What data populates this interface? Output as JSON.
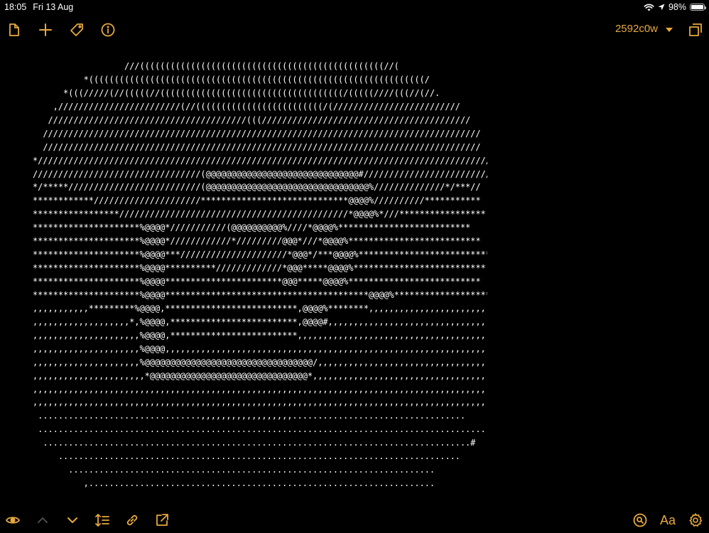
{
  "status_bar": {
    "time": "18:05",
    "date": "Fri 13 Aug",
    "battery_percent": "98%",
    "battery_level": 0.98,
    "icons": [
      "wifi-icon",
      "location-arrow-icon",
      "battery-icon"
    ]
  },
  "toolbar_top": {
    "left_icons": [
      "document-icon",
      "plus-icon",
      "tag-icon",
      "info-icon"
    ],
    "document_title": "2592c0w",
    "right_icons": [
      "chevron-down-icon",
      "window-icon"
    ]
  },
  "toolbar_bottom": {
    "left_icons": [
      "eye-icon",
      "chevron-up-icon",
      "chevron-down-icon",
      "line-spacing-icon",
      "link-icon",
      "share-icon"
    ],
    "right_icons": [
      "search-icon",
      "font-icon",
      "settings-icon"
    ],
    "font_label": "Aa"
  },
  "colors": {
    "accent": "#e8a93c",
    "background": "#000000",
    "text": "#ffffff",
    "disabled": "#4a4a4a"
  },
  "editor": {
    "lines": [
      "                  ///((((((((((((((((((((((((((((((((((((((((((((((((//(",
      "          *((((((((((((((((((((((((((((((((((((((((((((((((((((((((((((((((((/",
      "      *(((/////(//(((((//((((((((((((((((((((((((((((((((((((/(((((////(((//(//.",
      "    ,////////////////////////(//(((((((((((((((((((((((((/(/////////////////////////",
      "   ///////////////////////////////////////(((/////////////////////////////////////////",
      "  //////////////////////////////////////////////////////////////////////////////////////",
      "  //////////////////////////////////////////////////////////////////////////////////////",
      "*/////////////////////////////////////////////////////////////////////////////////////////",
      "/////////////////////////////////(@@@@@@@@@@@@@@@@@@@@@@@@@@@@@@#/////////////////////////",
      "*/*****//////////////////////////(@@@@@@@@@@@@@@@@@@@@@@@@@@@@@@@@%//////////////*/***//",
      "************/////////////////////*****************************@@@@%//////////***********",
      "*****************/////////////////////////////////////////////*@@@@%*///*****************",
      "*********************%@@@@*///////////(@@@@@@@@@@%////*@@@@%**************************",
      "*********************%@@@@*////////////*/////////@@@*///*@@@@%**************************",
      "*********************%@@@@***/////////////////////*@@@*/***@@@@%**************************",
      "*********************%@@@@**********/////////////*@@@*****@@@@%**************************",
      "*********************%@@@@***********************@@@*****@@@@%**************************",
      "*********************%@@@@****************************************@@@@%**************************",
      ",,,,,,,,,,,*********%@@@@,**************************,@@@@%********,,,,,,,,,,,,,,,,,,,,,,,",
      ",,,,,,,,,,,,,,,,,,,*,%@@@@,*************************,@@@@#,,,,,,,,,,,,,,,,,,,,,,,,,,,,,,,,",
      ",,,,,,,,,,,,,,,,,,,,,%@@@@,*************************,,,,,,,,,,,,,,,,,,,,,,,,,,,,,,,,,,,,,,,",
      ",,,,,,,,,,,,,,,,,,,,,%@@@@,,,,,,,,,,,,,,,,,,,,,,,,,,,,,,,,,,,,,,,,,,,,,,,,,,,,,,,,,,,,,,,,,,",
      ",,,,,,,,,,,,,,,,,,,,,%@@@@@@@@@@@@@@@@@@@@@@@@@@@@@@@@@/,,,,,,,,,,,,,,,,,,,,,,,,,,,,,,,,,,,,",
      ",,,,,,,,,,,,,,,,,,,,,,*@@@@@@@@@@@@@@@@@@@@@@@@@@@@@@@*,,,,,,,,,,,,,,,,,,,,,,,,,,,,,,,,,,,,,",
      ",,,,,,,,,,,,,,,,,,,,,,,,,,,,,,,,,,,,,,,,,,,,,,,,,,,,,,,,,,,,,,,,,,,,,,,,,,,,,,,,,,,,,,,,,,,,,",
      ",,,,,,,,,,,,,,,,,,,,,,,,,,,,,,,,,,,,,,,,,,,,,,,,,,,,,,,,,,,,,,,,,,,,,,,,,,,,,,,,,,,,,,,,,,,,,",
      " ................................,,,,,,,,,,,,,,,,,,..................................",
      " ........................................................................................./",
      "  ....................................................................................#",
      "     ...............................................................................",
      "       ........................................................................",
      "          ,...................................................................."
    ]
  }
}
